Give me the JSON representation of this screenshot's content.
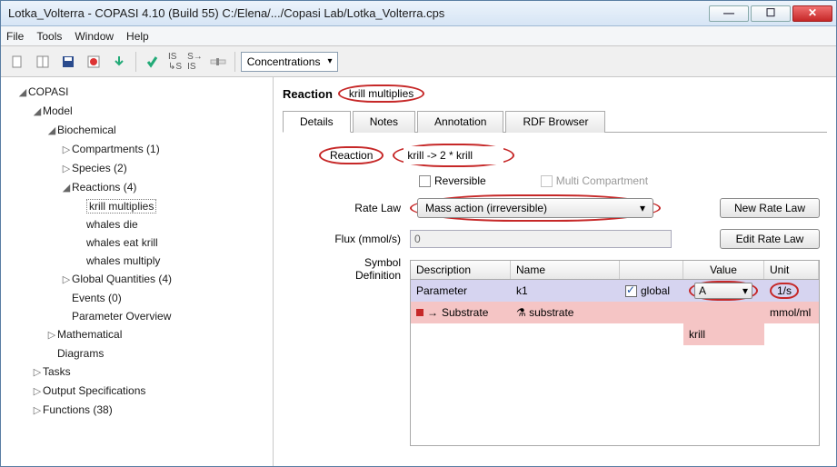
{
  "window": {
    "title": "Lotka_Volterra - COPASI 4.10 (Build 55) C:/Elena/.../Copasi Lab/Lotka_Volterra.cps"
  },
  "menubar": {
    "items": [
      "File",
      "Tools",
      "Window",
      "Help"
    ]
  },
  "toolbar": {
    "combo": "Concentrations"
  },
  "tree": {
    "root": "COPASI",
    "model": "Model",
    "biochem": "Biochemical",
    "compart": "Compartments (1)",
    "species": "Species (2)",
    "reactions": "Reactions (4)",
    "rx": [
      "krill multiplies",
      "whales die",
      "whales eat krill",
      "whales multiply"
    ],
    "gq": "Global Quantities (4)",
    "events": "Events (0)",
    "param": "Parameter Overview",
    "math": "Mathematical",
    "diag": "Diagrams",
    "tasks": "Tasks",
    "outspec": "Output Specifications",
    "funcs": "Functions (38)"
  },
  "main": {
    "header_label": "Reaction",
    "header_name": "krill multiplies",
    "tabs": [
      "Details",
      "Notes",
      "Annotation",
      "RDF Browser"
    ],
    "reaction_label": "Reaction",
    "reaction_value": "krill -> 2 * krill",
    "reversible_label": "Reversible",
    "multicomp_label": "Multi Compartment",
    "ratelaw_label": "Rate Law",
    "ratelaw_value": "Mass action (irreversible)",
    "new_ratelaw": "New Rate Law",
    "edit_ratelaw": "Edit Rate Law",
    "flux_label": "Flux (mmol/s)",
    "flux_value": "0",
    "symdef_label": "Symbol Definition"
  },
  "table": {
    "cols": [
      "Description",
      "Name",
      "",
      "Value",
      "Unit"
    ],
    "r1": {
      "desc": "Parameter",
      "name": "k1",
      "chk": "global",
      "val": "A",
      "unit": "1/s"
    },
    "r2": {
      "desc": "Substrate",
      "name": "substrate",
      "unit": "mmol/ml"
    },
    "r3": {
      "val": "krill"
    }
  }
}
